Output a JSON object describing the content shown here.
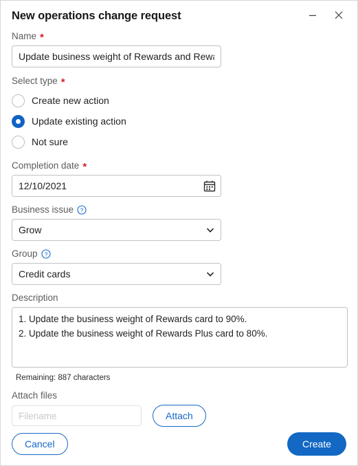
{
  "window": {
    "title": "New operations change request",
    "minimize_icon": "minimize-icon",
    "close_icon": "close-icon"
  },
  "form": {
    "name": {
      "label": "Name",
      "required_marker": "*",
      "value": "Update business weight of Rewards and Rewards Plus cards",
      "placeholder": ""
    },
    "select_type": {
      "label": "Select type",
      "required_marker": "*",
      "options": [
        {
          "label": "Create new action",
          "selected": false
        },
        {
          "label": "Update existing action",
          "selected": true
        },
        {
          "label": "Not sure",
          "selected": false
        }
      ]
    },
    "completion_date": {
      "label": "Completion date",
      "required_marker": "*",
      "value": "12/10/2021",
      "calendar_icon": "calendar-icon"
    },
    "business_issue": {
      "label": "Business issue",
      "help_icon": "help-circle-icon",
      "value": "Grow",
      "chevron_icon": "chevron-down-icon"
    },
    "group": {
      "label": "Group",
      "help_icon": "help-circle-icon",
      "value": "Credit cards",
      "chevron_icon": "chevron-down-icon"
    },
    "description": {
      "label": "Description",
      "value": "1. Update the business weight of Rewards card to 90%.\n2. Update the business weight of Rewards Plus card to 80%.",
      "remaining": "Remaining: 887 characters"
    },
    "attach_files": {
      "label": "Attach files",
      "filename_placeholder": "Filename",
      "filename_value": "",
      "attach_button": "Attach"
    }
  },
  "actions": {
    "cancel": "Cancel",
    "create": "Create"
  },
  "colors": {
    "accent": "#1268c3",
    "radio_selected": "#0f62c4",
    "required": "#d32029",
    "label": "#5c5c5c",
    "border": "#c2c2c2"
  }
}
